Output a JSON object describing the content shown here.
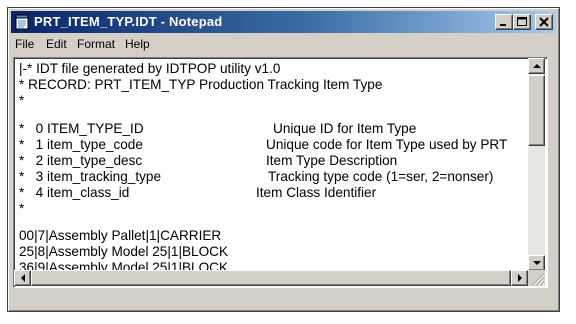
{
  "window": {
    "title": "PRT_ITEM_TYP.IDT - Notepad"
  },
  "menu": [
    "File",
    "Edit",
    "Format",
    "Help"
  ],
  "icons": {
    "app": "notepad-icon",
    "minimize": "minimize-icon",
    "maximize": "maximize-icon",
    "close": "close-icon",
    "scroll_up": "arrow-up-icon",
    "scroll_down": "arrow-down-icon",
    "scroll_left": "arrow-left-icon",
    "scroll_right": "arrow-right-icon",
    "resize": "resize-grip-icon"
  },
  "document": {
    "header": [
      "|-* IDT file generated by IDTPOP utility v1.0",
      "* RECORD: PRT_ITEM_TYP Production Tracking Item Type",
      "*"
    ],
    "fields": [
      {
        "prefix": "*   0 ITEM_TYPE_ID",
        "desc": "Unique ID for Item Type"
      },
      {
        "prefix": "*   1 item_type_code",
        "desc": "Unique code for Item Type used by PRT"
      },
      {
        "prefix": "*   2 item_type_desc",
        "desc": "Item Type Description"
      },
      {
        "prefix": "*   3 item_tracking_type",
        "desc": "Tracking type code (1=ser, 2=nonser)"
      },
      {
        "prefix": "*   4 item_class_id",
        "desc": "Item Class Identifier"
      }
    ],
    "separator": "*",
    "records": [
      "00|7|Assembly Pallet|1|CARRIER",
      "25|8|Assembly Model 25|1|BLOCK",
      "36|9|Assembly Model 25|1|BLOCK"
    ]
  },
  "colors": {
    "title_bar_start": "#0a246a",
    "title_bar_end": "#a6caf0",
    "chrome": "#d4d0c8"
  }
}
